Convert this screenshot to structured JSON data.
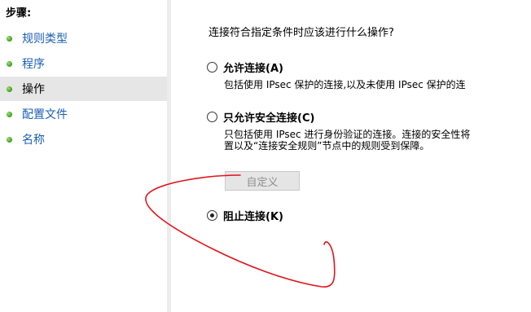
{
  "steps": {
    "title": "步骤:",
    "items": [
      {
        "label": "规则类型"
      },
      {
        "label": "程序"
      },
      {
        "label": "操作"
      },
      {
        "label": "配置文件"
      },
      {
        "label": "名称"
      }
    ],
    "selected": "操作"
  },
  "action": {
    "question": "连接符合指定条件时应该进行什么操作?",
    "options": [
      {
        "label": "允许连接(A)",
        "desc": [
          "包括使用 IPsec 保护的连接,以及未使用 IPsec 保护的连"
        ],
        "checked": false
      },
      {
        "label": "只允许安全连接(C)",
        "desc": [
          "只包括使用 IPsec 进行身份验证的连接。连接的安全性将",
          "置以及“连接安全规则”节点中的规则受到保障。"
        ],
        "checked": false
      },
      {
        "label": "阻止连接(K)",
        "desc": [],
        "checked": true
      }
    ],
    "customize_button": "自定义"
  },
  "annotation_color": "#e0141b"
}
